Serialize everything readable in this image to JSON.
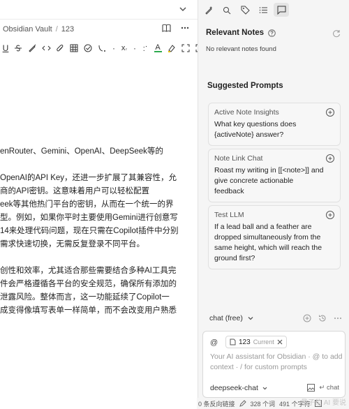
{
  "editor": {
    "breadcrumb": [
      "Obsidian Vault",
      "123"
    ],
    "separator": "/",
    "content": [
      "enRouter、Gemini、OpenAI、DeepSeek等的",
      "",
      "OpenAI的API Key，还进一步扩展了其兼容性，允",
      "商的API密钥。这意味着用户可以轻松配置",
      "eek等其他热门平台的密钥，从而在一个统一的界",
      "型。例如，如果你平时主要使用Gemini进行创意写",
      "14来处理代码问题，现在只需在Copilot插件中分别",
      "需求快速切换，无需反复登录不同平台。",
      "",
      "创性和效率，尤其适合那些需要结合多种AI工具完",
      "件会严格遵循各平台的安全规范，确保所有添加的",
      "泄露风险。整体而言，这一功能延续了Copilot一",
      "成变得像填写表单一样简单，而不会改变用户熟悉"
    ]
  },
  "sidebar": {
    "relevant_title": "Relevant Notes",
    "relevant_empty": "No relevant notes found",
    "suggested_title": "Suggested Prompts",
    "prompts": [
      {
        "title": "Active Note Insights",
        "text": "What key questions does {activeNote} answer?"
      },
      {
        "title": "Note Link Chat",
        "text": "Roast my writing in [[<note>]] and give concrete actionable feedback"
      },
      {
        "title": "Test LLM",
        "text": "If a lead ball and a feather are dropped simultaneously from the same height, which will reach the ground first?"
      }
    ],
    "chat_mode": "chat (free)",
    "input": {
      "at": "@",
      "context_pill": "123",
      "context_tag": "Current",
      "placeholder": "Your AI assistant for Obsidian · @ to add context · / for custom prompts",
      "model": "deepseek-chat",
      "send_label": "chat"
    }
  },
  "status": {
    "backlinks": "0 条反向链接",
    "words": "328 个词",
    "chars": "491 个字符"
  },
  "watermark": "量子位 AI 要说"
}
